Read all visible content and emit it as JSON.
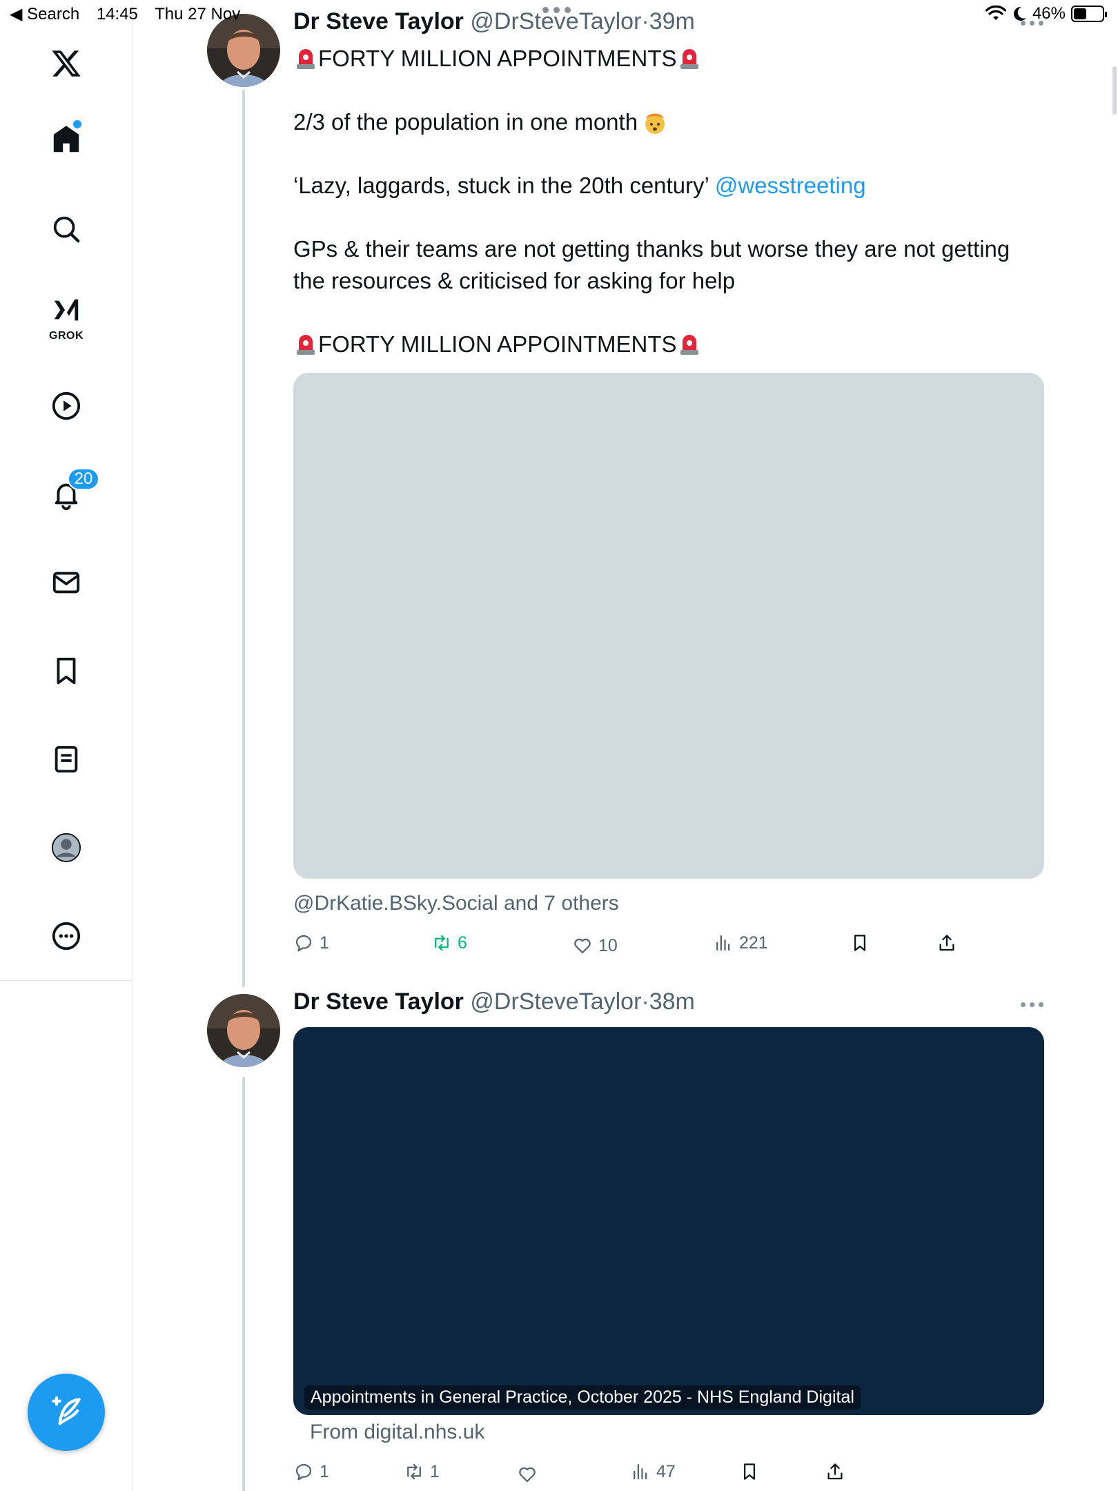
{
  "status_bar": {
    "back_label": "◀ Search",
    "time": "14:45",
    "date": "Thu 27 Nov",
    "battery": "46%",
    "battery_level": 0.46
  },
  "sidebar": {
    "logo": "x-logo-icon",
    "items": [
      {
        "name": "home",
        "icon": "home-icon"
      },
      {
        "name": "search",
        "icon": "search-icon"
      },
      {
        "name": "grok",
        "icon": "grok-icon",
        "label": "GROK"
      },
      {
        "name": "video",
        "icon": "play-icon"
      },
      {
        "name": "notifications",
        "icon": "bell-icon",
        "badge": "20"
      },
      {
        "name": "messages",
        "icon": "mail-icon"
      },
      {
        "name": "bookmarks",
        "icon": "bookmark-icon"
      },
      {
        "name": "articles",
        "icon": "article-icon"
      },
      {
        "name": "profile",
        "icon": "avatar-icon"
      },
      {
        "name": "more",
        "icon": "more-icon"
      }
    ],
    "compose_icon": "compose-post-icon"
  },
  "colors": {
    "accent": "#1d9bf0",
    "retweet": "#00ba7c",
    "media_placeholder": "#cfd9de",
    "card_background": "#0c2640"
  },
  "tweets": [
    {
      "name": "Dr Steve Taylor",
      "handle": "@DrSteveTaylor",
      "separator": "·",
      "time": "39m",
      "text": {
        "line1": "FORTY MILLION APPOINTMENTS",
        "line2": "2/3 of the population in one month",
        "line3": "‘Lazy, laggards, stuck in the 20th century’ ",
        "mention": "@wesstreeting",
        "line4a": "GPs & their teams are not getting thanks but worse they are not getting",
        "line4b": "the resources & criticised for asking for help",
        "line5": "FORTY MILLION APPOINTMENTS"
      },
      "tagged": "@DrKatie.BSky.Social and 7 others",
      "stats": {
        "replies": "1",
        "reposts": "6",
        "likes": "10",
        "views": "221"
      }
    },
    {
      "name": "Dr Steve Taylor",
      "handle": "@DrSteveTaylor",
      "separator": "·",
      "time": "38m",
      "card": {
        "caption": "Appointments in General Practice, October 2025 - NHS England Digital",
        "source": "From digital.nhs.uk"
      },
      "stats": {
        "replies": "1",
        "reposts": "1",
        "likes": "",
        "views": "47"
      }
    }
  ]
}
